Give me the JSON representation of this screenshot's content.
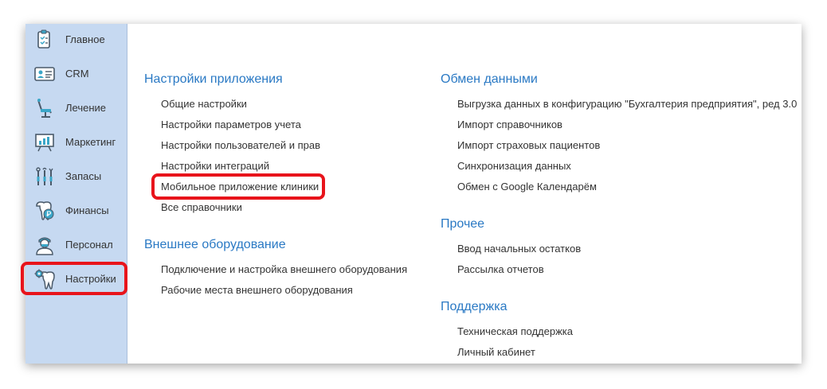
{
  "sidebar": {
    "items": [
      {
        "label": "Главное",
        "icon": "checklist-icon"
      },
      {
        "label": "CRM",
        "icon": "id-card-icon"
      },
      {
        "label": "Лечение",
        "icon": "dental-chair-icon"
      },
      {
        "label": "Маркетинг",
        "icon": "presentation-board-icon"
      },
      {
        "label": "Запасы",
        "icon": "dental-tools-icon"
      },
      {
        "label": "Финансы",
        "icon": "tooth-ruble-icon"
      },
      {
        "label": "Персонал",
        "icon": "doctor-icon"
      },
      {
        "label": "Настройки",
        "icon": "tooth-gear-icon"
      }
    ]
  },
  "sections": {
    "app_settings": {
      "title": "Настройки приложения",
      "links": [
        "Общие настройки",
        "Настройки параметров учета",
        "Настройки пользователей и прав",
        "Настройки интеграций",
        "Мобильное приложение клиники",
        "Все справочники"
      ]
    },
    "external_equipment": {
      "title": "Внешнее оборудование",
      "links": [
        "Подключение и настройка внешнего оборудования",
        "Рабочие места внешнего оборудования"
      ]
    },
    "data_exchange": {
      "title": "Обмен данными",
      "links": [
        "Выгрузка данных в конфигурацию \"Бухгалтерия предприятия\", ред 3.0",
        "Импорт справочников",
        "Импорт страховых пациентов",
        "Синхронизация данных",
        "Обмен с Google Календарём"
      ]
    },
    "other": {
      "title": "Прочее",
      "links": [
        "Ввод начальных остатков",
        "Рассылка отчетов"
      ]
    },
    "support": {
      "title": "Поддержка",
      "links": [
        "Техническая поддержка",
        "Личный кабинет"
      ]
    }
  },
  "colors": {
    "sidebar_bg": "#c6d9f1",
    "section_title": "#2a79c4",
    "highlight": "#e8141b",
    "icon_stroke": "#4a5a6a",
    "icon_accent": "#3aa6c8"
  }
}
